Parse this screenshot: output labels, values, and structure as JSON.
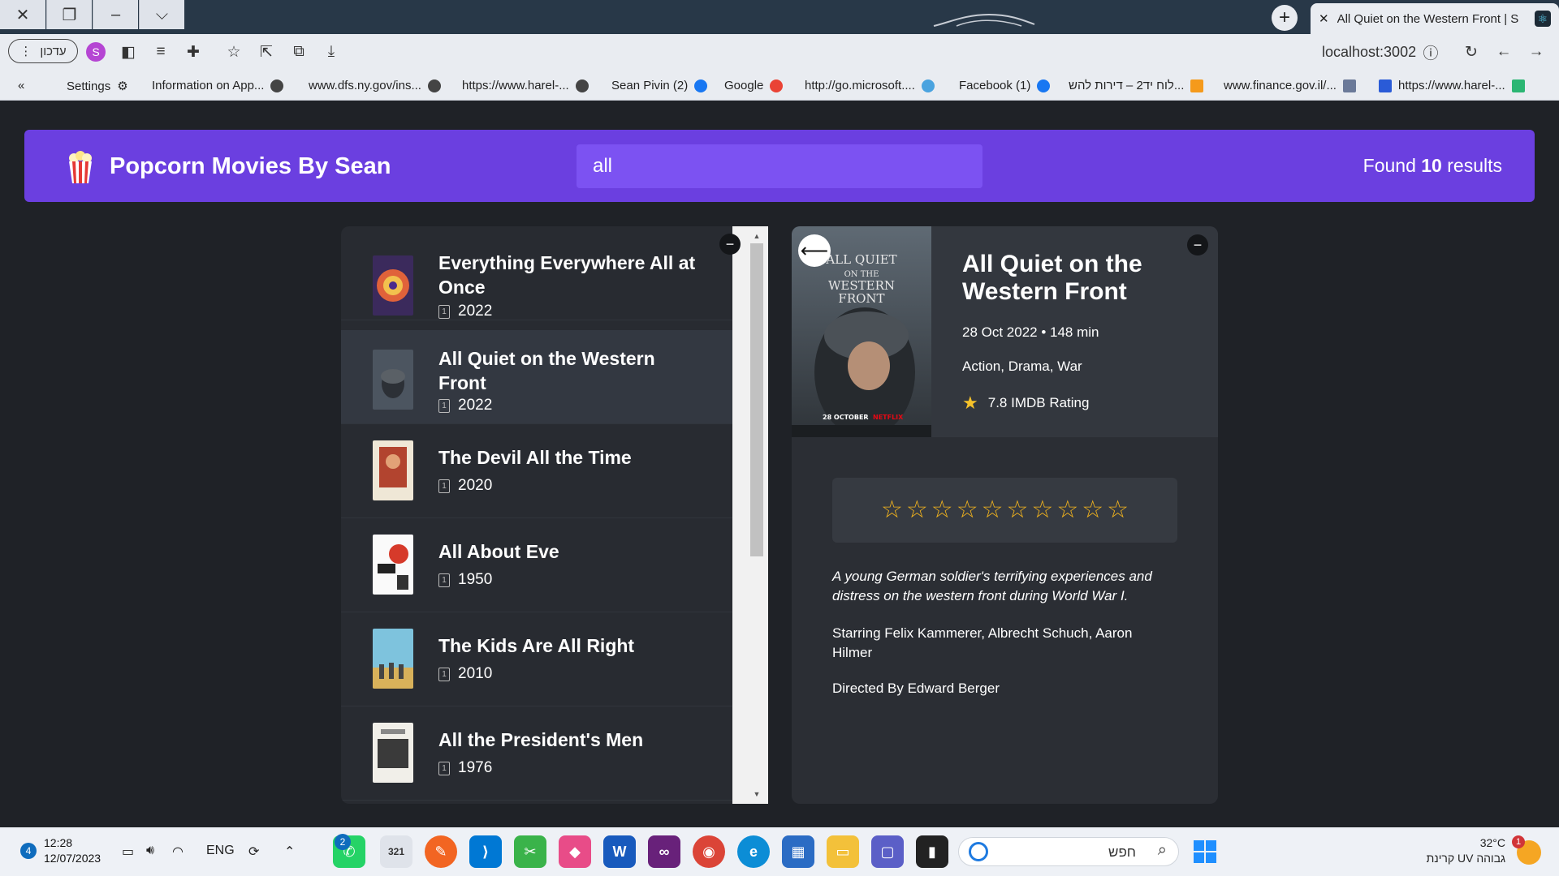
{
  "browser": {
    "tab_title": "All Quiet on the Western Front | S",
    "url": "localhost:3002",
    "profile_label": "עדכון",
    "profile_initial": "S",
    "bookmarks": [
      {
        "label": "Settings",
        "icon": "gear-icon"
      },
      {
        "label": "Information on App...",
        "icon": "globe-icon"
      },
      {
        "label": "www.dfs.ny.gov/ins...",
        "icon": "globe-icon"
      },
      {
        "label": "https://www.harel-...",
        "icon": "globe-icon"
      },
      {
        "label": "Sean Pivin (2)",
        "icon": "facebook-icon"
      },
      {
        "label": "Google",
        "icon": "google-icon"
      },
      {
        "label": "http://go.microsoft....",
        "icon": "edge-icon"
      },
      {
        "label": "Facebook (1)",
        "icon": "facebook-icon"
      },
      {
        "label": "לוח יד2 – דירות להש...",
        "icon": "yad2-icon"
      },
      {
        "label": "www.finance.gov.il/...",
        "icon": "gov-icon"
      },
      {
        "label": "https://www.harel-...",
        "icon": "harel-icon"
      }
    ]
  },
  "app": {
    "title": "Popcorn Movies By Sean",
    "search_value": "all",
    "results_prefix": "Found",
    "results_count": "10",
    "results_suffix": "results",
    "accent_color": "#6b3fe0"
  },
  "movies": [
    {
      "title": "Everything Everywhere All at Once",
      "year": "2022"
    },
    {
      "title": "All Quiet on the Western Front",
      "year": "2022"
    },
    {
      "title": "The Devil All the Time",
      "year": "2020"
    },
    {
      "title": "All About Eve",
      "year": "1950"
    },
    {
      "title": "The Kids Are All Right",
      "year": "2010"
    },
    {
      "title": "All the President's Men",
      "year": "1976"
    }
  ],
  "detail": {
    "title": "All Quiet on the Western Front",
    "date_runtime": "28 Oct 2022 • 148 min",
    "genres": "Action, Drama, War",
    "rating": "7.8 IMDB Rating",
    "user_rating_stars": 10,
    "plot": "A young German soldier's terrifying experiences and distress on the western front during World War I.",
    "starring": "Starring Felix Kammerer, Albrecht Schuch, Aaron Hilmer",
    "director": "Directed By Edward Berger",
    "poster_text": [
      "ALL QUIET",
      "ON THE",
      "WESTERN",
      "FRONT"
    ],
    "poster_footer": "28 OCTOBER",
    "poster_brand": "NETFLIX"
  },
  "taskbar": {
    "time": "12:28",
    "date": "12/07/2023",
    "notification_count": "4",
    "language": "ENG",
    "search_text": "חפש",
    "temperature": "32°C",
    "weather_text": "קרינת UV גבוהה",
    "weather_badge": "1",
    "whatsapp_badge": "2",
    "calendar_day": "321"
  }
}
